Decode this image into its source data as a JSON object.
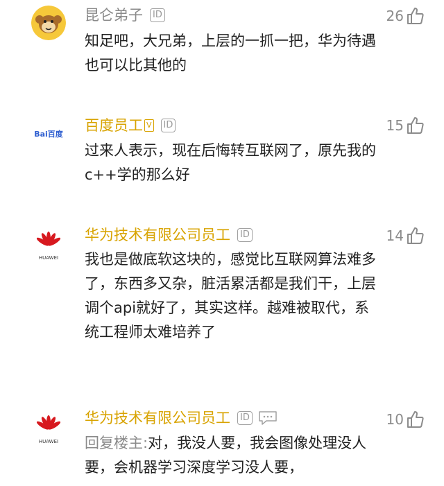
{
  "comments": [
    {
      "author": "昆仑弟子",
      "author_color": "#8a8a8a",
      "avatar": "monkey-avatar",
      "id_badge": "ID",
      "likes": "26",
      "text": "知足吧，大兄弟，上层的一抓一把，华为待遇也可以比其他的"
    },
    {
      "author": "百度员工",
      "author_color": "#d8a300",
      "avatar": "baidu-logo",
      "avatar_text": "Bai百度",
      "staff_badge": "V",
      "id_badge": "ID",
      "likes": "15",
      "text": "过来人表示，现在后悔转互联网了，原先我的c++学的那么好"
    },
    {
      "author": "华为技术有限公司员工",
      "author_color": "#d8a300",
      "avatar": "huawei-logo",
      "avatar_text": "HUAWEI",
      "id_badge": "ID",
      "likes": "14",
      "text": "我也是做底软这块的，感觉比互联网算法难多了，东西多又杂，脏活累活都是我们干，上层调个api就好了，其实这样。越难被取代，系统工程师太难培养了"
    },
    {
      "author": "华为技术有限公司员工",
      "author_color": "#d8a300",
      "avatar": "huawei-logo",
      "avatar_text": "HUAWEI",
      "id_badge": "ID",
      "likes": "10",
      "reply_prefix": "回复楼主:",
      "text": "对，我没人要，我会图像处理没人要，会机器学习深度学习没人要，"
    }
  ]
}
